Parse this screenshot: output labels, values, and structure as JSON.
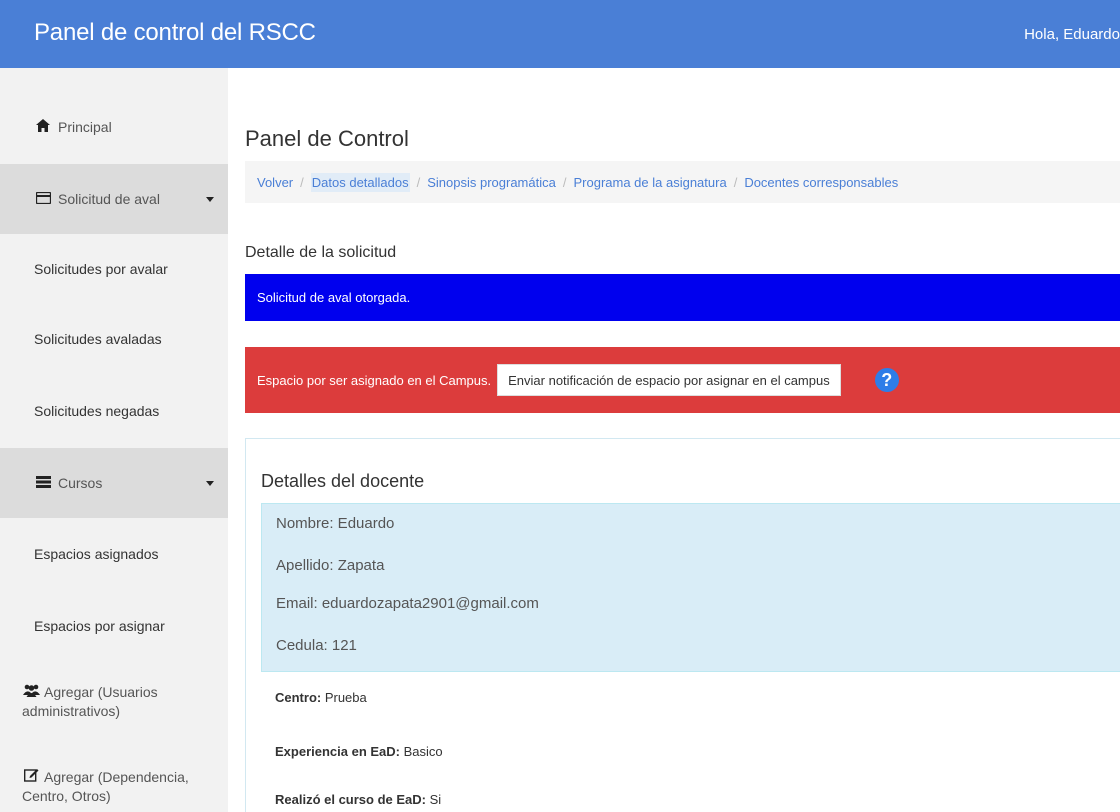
{
  "navbar": {
    "brand": "Panel de control del RSCC",
    "greeting": "Hola, Eduardo"
  },
  "sidebar": {
    "items": [
      {
        "label": "Principal",
        "icon": "home-icon"
      },
      {
        "label": "Solicitud de aval",
        "icon": "card-icon"
      },
      {
        "label": "Solicitudes por avalar"
      },
      {
        "label": "Solicitudes avaladas"
      },
      {
        "label": "Solicitudes negadas"
      },
      {
        "label": "Cursos",
        "icon": "list-icon"
      },
      {
        "label": "Espacios asignados"
      },
      {
        "label": "Espacios por asignar"
      },
      {
        "label_line1": "Agregar (Usuarios",
        "label_line2": "administrativos)",
        "icon": "users-icon"
      },
      {
        "label_line1": "Agregar (Dependencia,",
        "label_line2": "Centro, Otros)",
        "icon": "edit-icon"
      }
    ]
  },
  "main": {
    "title": "Panel de Control",
    "breadcrumb": [
      "Volver",
      "Datos detallados",
      "Sinopsis programática",
      "Programa de la asignatura",
      "Docentes corresponsables"
    ],
    "section_title": "Detalle de la solicitud",
    "alert_success": "Solicitud de aval otorgada.",
    "alert_space": "Espacio por ser asignado en el Campus.",
    "notify_button": "Enviar notificación de espacio por asignar en el campus",
    "help_icon": "?",
    "panel": {
      "title": "Detalles del docente",
      "nombre": "Nombre: Eduardo",
      "apellido": "Apellido: Zapata",
      "email": "Email: eduardozapata2901@gmail.com",
      "cedula": "Cedula: 121",
      "centro_label": "Centro:",
      "centro_value": " Prueba",
      "experiencia_label": "Experiencia en EaD:",
      "experiencia_value": " Basico",
      "curso_label": "Realizó el curso de EaD:",
      "curso_value": " Si"
    }
  },
  "colors": {
    "navbar": "#4a7fd6",
    "alert_blue": "#0000ee",
    "alert_red": "#dc3c3c",
    "info_box": "#d9edf7",
    "link": "#4a7fd6"
  }
}
